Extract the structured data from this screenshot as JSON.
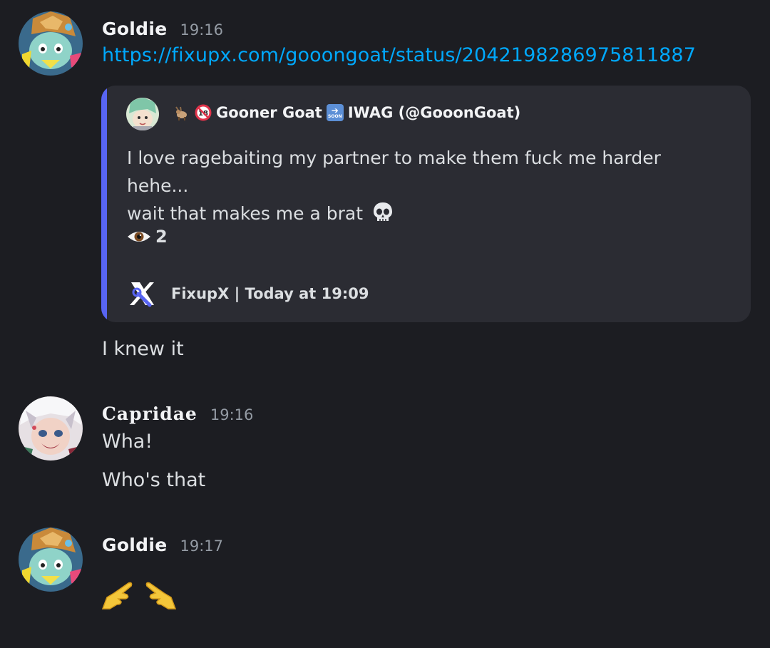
{
  "messages": [
    {
      "author": "Goldie",
      "time": "19:16",
      "link": "https://fixupx.com/gooongoat/status/2042198286975811887",
      "followup": "I knew it"
    },
    {
      "author": "Capridae",
      "time": "19:16",
      "lines": [
        "Wha!",
        "Who's that"
      ]
    },
    {
      "author": "Goldie",
      "time": "19:17",
      "emojis": [
        "pointing-right-hand-emoji",
        "pointing-left-hand-emoji"
      ]
    }
  ],
  "embed": {
    "author_prefix_icons": [
      "goat-emoji",
      "no-under-18-emoji"
    ],
    "author_name": "Gooner Goat",
    "soon_badge": "SOON",
    "author_suffix": "IWAG (@GooonGoat)",
    "text_line1": "I love ragebaiting my partner to make them fuck me harder hehe...",
    "text_line2": "wait that makes me a brat",
    "text_emoji": "skull-emoji",
    "views_icon": "eye-icon",
    "views": "2",
    "footer": "FixupX | Today at 19:09",
    "accent_color": "#5865f2"
  },
  "colors": {
    "background": "#1c1d22",
    "link": "#00a8fc",
    "embed_bg": "#2b2c33",
    "timestamp": "#949ba4"
  }
}
